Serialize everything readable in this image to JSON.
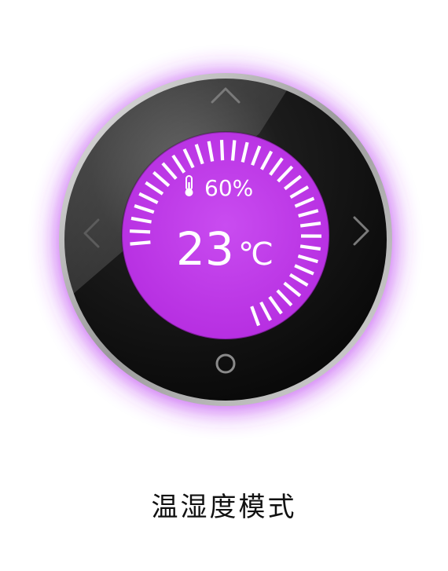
{
  "display": {
    "humidity_text": "60%",
    "temperature_value": "23",
    "temperature_unit": "℃",
    "level": 0.78
  },
  "icons": {
    "up": "chevron-up-icon",
    "down": "power-ring-icon",
    "left": "chevron-left-icon",
    "right": "chevron-right-icon",
    "humidity": "thermometer-icon"
  },
  "mode": {
    "label": "温湿度模式"
  },
  "colors": {
    "accent": "#c028e6",
    "screen": "#c13ae8",
    "glow": "#b52ef0",
    "bezel": "#161616",
    "ring": "#c8c8c8",
    "control_icon": "#7a7a7a",
    "text_on_screen": "#ffffff"
  }
}
